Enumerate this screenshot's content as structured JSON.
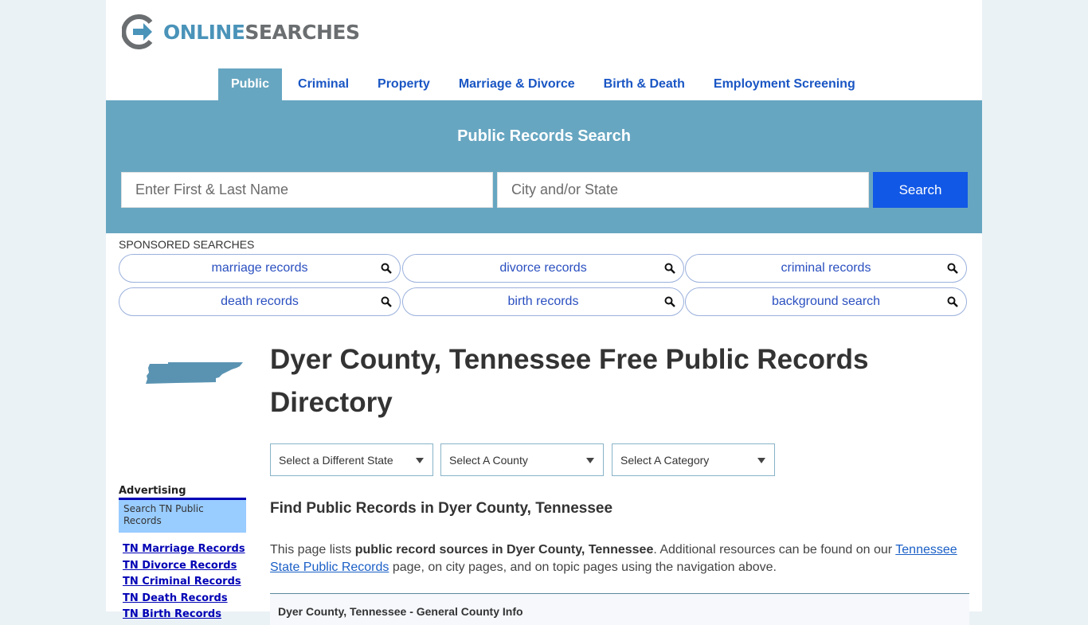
{
  "logo": {
    "online": "ONLINE",
    "searches": "SEARCHES"
  },
  "nav": {
    "items": [
      {
        "label": "Public",
        "active": true
      },
      {
        "label": "Criminal"
      },
      {
        "label": "Property"
      },
      {
        "label": "Marriage & Divorce"
      },
      {
        "label": "Birth & Death"
      },
      {
        "label": "Employment Screening"
      }
    ]
  },
  "hero": {
    "title": "Public Records Search",
    "name_placeholder": "Enter First & Last Name",
    "city_placeholder": "City and/or State",
    "search_label": "Search"
  },
  "sponsored": {
    "label": "SPONSORED SEARCHES",
    "items": [
      "marriage records",
      "divorce records",
      "criminal records",
      "death records",
      "birth records",
      "background search"
    ]
  },
  "sidebar": {
    "advertising_label": "Advertising",
    "ad_box": "Search TN Public Records",
    "links": [
      "TN Marriage Records",
      "TN Divorce Records",
      "TN Criminal Records",
      "TN Death Records",
      "TN Birth Records"
    ]
  },
  "main": {
    "title": "Dyer County, Tennessee Free Public Records Directory",
    "selects": [
      "Select a Different State",
      "Select A County",
      "Select A Category"
    ],
    "subtitle": "Find Public Records in Dyer County, Tennessee",
    "intro": {
      "pre": "This page lists ",
      "bold": "public record sources in Dyer County, Tennessee",
      "mid": ". Additional resources can be found on our ",
      "link": "Tennessee State Public Records",
      "post": " page, on city pages, and on topic pages using the navigation above."
    },
    "info_box_title": "Dyer County, Tennessee - General County Info"
  },
  "colors": {
    "accent": "#67a6c1",
    "nav_link": "#1a56c4",
    "search_button": "#1158e6",
    "page_bg": "#eaf2f6"
  }
}
